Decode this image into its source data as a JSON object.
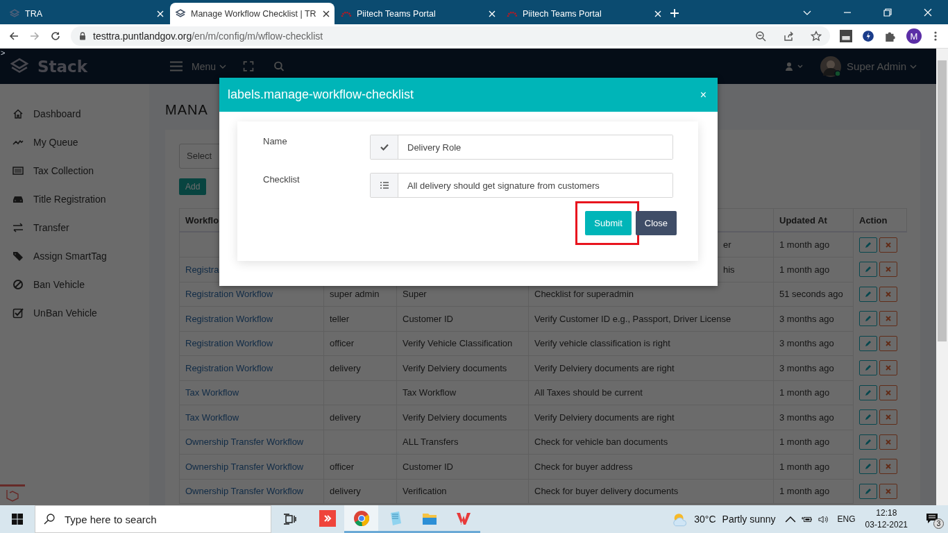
{
  "browser": {
    "tabs": [
      {
        "title": "TRA",
        "selected": false,
        "kind": "stack"
      },
      {
        "title": "Manage Workflow Checklist | TR",
        "selected": true,
        "kind": "stack"
      },
      {
        "title": "Piitech Teams Portal",
        "selected": false,
        "kind": "portal"
      },
      {
        "title": "Piitech Teams Portal",
        "selected": false,
        "kind": "portal"
      }
    ],
    "url_host": "testtra.puntlandgov.org",
    "url_path": "/en/m/config/m/wflow-checklist",
    "profile": "M"
  },
  "debug_mark": ">",
  "header": {
    "brand": "Stack",
    "menu": "Menu",
    "user": "Super Admin"
  },
  "sidebar": {
    "items": [
      {
        "label": "Dashboard"
      },
      {
        "label": "My Queue"
      },
      {
        "label": "Tax Collection"
      },
      {
        "label": "Title Registration"
      },
      {
        "label": "Transfer"
      },
      {
        "label": "Assign SmartTag"
      },
      {
        "label": "Ban Vehicle"
      },
      {
        "label": "UnBan Vehicle"
      }
    ]
  },
  "page": {
    "heading": "MANA",
    "select_placeholder": "Select",
    "add_button": "Add",
    "table": {
      "columns": {
        "workflow": "Workflo",
        "updated_at": "Updated At",
        "action": "Action"
      },
      "rows": [
        {
          "description_tail": "er",
          "updated": "1 month ago"
        },
        {
          "workflow": "Registra",
          "description_tail": "his",
          "updated": "1 month ago"
        },
        {
          "workflow": "Registration Workflow",
          "role": "super admin",
          "checklist": "Super",
          "description": "Checklist for superadmin",
          "updated": "51 seconds ago"
        },
        {
          "workflow": "Registration Workflow",
          "role": "teller",
          "checklist": "Customer ID",
          "description": "Verify Customer ID e.g., Passport, Driver License",
          "updated": "3 months ago"
        },
        {
          "workflow": "Registration Workflow",
          "role": "officer",
          "checklist": "Verify Vehicle Classification",
          "description": "Verify vehicle classification is right",
          "updated": "3 months ago"
        },
        {
          "workflow": "Registration Workflow",
          "role": "delivery",
          "checklist": "Verify Delviery documents",
          "description": "Verify Delviery documents are right",
          "updated": "3 months ago"
        },
        {
          "workflow": "Tax Workflow",
          "checklist": "Tax Workflow",
          "description": "All Taxes should be current",
          "updated": "1 month ago"
        },
        {
          "workflow": "Tax Workflow",
          "role": "delivery",
          "checklist": "Verify Delviery documents",
          "description": "Verify Delviery documents are right",
          "updated": "3 months ago"
        },
        {
          "workflow": "Ownership Transfer Workflow",
          "checklist": "ALL Transfers",
          "description": "Check for vehicle ban documents",
          "updated": "1 month ago"
        },
        {
          "workflow": "Ownership Transfer Workflow",
          "role": "officer",
          "checklist": "Customer ID",
          "description": "Check for buyer address",
          "updated": "1 month ago"
        },
        {
          "workflow": "Ownership Transfer Workflow",
          "role": "delivery",
          "checklist": "Verification",
          "description": "Check for buyer delivery documents",
          "updated": "1 month ago"
        }
      ]
    }
  },
  "modal": {
    "title": "labels.manage-workflow-checklist",
    "close": "×",
    "fields": [
      {
        "label": "Name",
        "value": "Delivery Role",
        "kind": "check"
      },
      {
        "label": "Checklist",
        "value": "All delivery should get signature from customers",
        "kind": "list"
      }
    ],
    "buttons": [
      {
        "label": "Submit",
        "kind": "primary",
        "highlighted": true
      },
      {
        "label": "Close",
        "kind": "secondary",
        "highlighted": false
      }
    ]
  },
  "taskbar": {
    "search_placeholder": "Type here to search",
    "apps": [
      {
        "running": false,
        "selected": false
      },
      {
        "running": true,
        "selected": true
      },
      {
        "running": true,
        "selected": false
      },
      {
        "running": true,
        "selected": false
      },
      {
        "running": true,
        "selected": false
      }
    ],
    "temperature": "30°C",
    "weather": "Partly sunny",
    "language": "ENG",
    "time": "12:18",
    "date": "03-12-2021",
    "notifications": "3"
  }
}
